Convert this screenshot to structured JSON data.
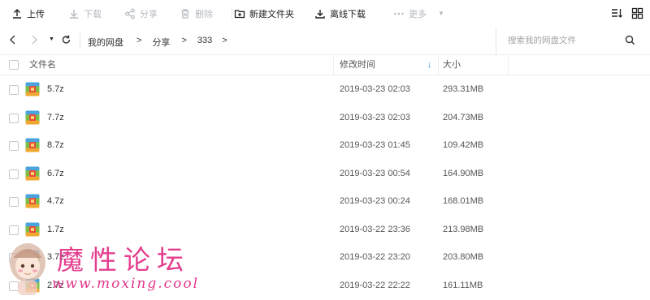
{
  "toolbar": {
    "upload": "上传",
    "download": "下载",
    "share": "分享",
    "delete": "删除",
    "new_folder": "新建文件夹",
    "offline_download": "离线下载",
    "more": "更多"
  },
  "nav": {
    "breadcrumb": [
      "我的网盘",
      ">",
      "分享",
      ">",
      "333",
      ">"
    ],
    "search_placeholder": "搜索我的网盘文件"
  },
  "table": {
    "col_name": "文件名",
    "col_modified": "修改时间",
    "col_size": "大小",
    "sort_indicator": "↓",
    "rows": [
      {
        "name": "5.7z",
        "modified": "2019-03-23 02:03",
        "size": "293.31MB"
      },
      {
        "name": "7.7z",
        "modified": "2019-03-23 02:03",
        "size": "204.73MB"
      },
      {
        "name": "8.7z",
        "modified": "2019-03-23 01:45",
        "size": "109.42MB"
      },
      {
        "name": "6.7z",
        "modified": "2019-03-23 00:54",
        "size": "164.90MB"
      },
      {
        "name": "4.7z",
        "modified": "2019-03-23 00:24",
        "size": "168.01MB"
      },
      {
        "name": "1.7z",
        "modified": "2019-03-22 23:36",
        "size": "213.98MB"
      },
      {
        "name": "3.7z",
        "modified": "2019-03-22 23:20",
        "size": "203.80MB"
      },
      {
        "name": "2.7z",
        "modified": "2019-03-22 22:22",
        "size": "161.11MB"
      }
    ]
  },
  "watermark": {
    "title": "魔性论坛",
    "url": "www.moxing.cool"
  },
  "colors": {
    "accent": "#2196f3",
    "watermark": "#e3348a",
    "disabled_text": "#b5b9c0"
  }
}
